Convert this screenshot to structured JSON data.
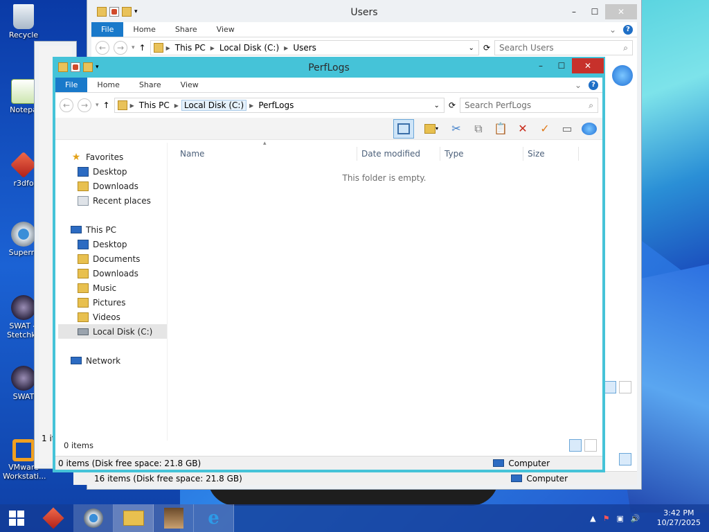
{
  "desktop": {
    "icons": [
      {
        "label": "Recycle",
        "icon": "recycle-bin-icon"
      },
      {
        "label": "Notepa",
        "icon": "notepad-icon"
      },
      {
        "label": "r3dfo",
        "icon": "r3dfox-icon"
      },
      {
        "label": "Superm",
        "icon": "supermium-icon"
      },
      {
        "label": "SWAT 4 Stetchko",
        "icon": "swat4-icon"
      },
      {
        "label": "SWAT",
        "icon": "swat-icon"
      },
      {
        "label": "VMware Workstati...",
        "icon": "vmware-icon"
      }
    ]
  },
  "back_window": {
    "title": "Users",
    "tabs": [
      "File",
      "Home",
      "Share",
      "View"
    ],
    "breadcrumb": [
      "This PC",
      "Local Disk (C:)",
      "Users"
    ],
    "search_placeholder": "Search Users",
    "status_left": "1 it",
    "bottom_status": "16 items (Disk free space: 21.8 GB)",
    "bottom_location": "Computer"
  },
  "window": {
    "title": "PerfLogs",
    "tabs": [
      "File",
      "Home",
      "Share",
      "View"
    ],
    "breadcrumb": [
      "This PC",
      "Local Disk (C:)",
      "PerfLogs"
    ],
    "search_placeholder": "Search PerfLogs",
    "columns": [
      "Name",
      "Date modified",
      "Type",
      "Size"
    ],
    "empty_message": "This folder is empty.",
    "nav": {
      "favorites_label": "Favorites",
      "favorites": [
        "Desktop",
        "Downloads",
        "Recent places"
      ],
      "thispc_label": "This PC",
      "thispc": [
        "Desktop",
        "Documents",
        "Downloads",
        "Music",
        "Pictures",
        "Videos",
        "Local Disk (C:)"
      ],
      "network_label": "Network",
      "selected": "Local Disk (C:)"
    },
    "item_count": "0 items",
    "bottom_status": "0 items (Disk free space: 21.8 GB)",
    "bottom_location": "Computer"
  },
  "back_window_left": {
    "status": "1 it"
  },
  "taskbar": {
    "apps": [
      "start-icon",
      "r3dfox-icon",
      "supermium-icon",
      "file-explorer-icon",
      "game-icon",
      "internet-explorer-icon"
    ],
    "active_app": "file-explorer-icon",
    "time": "3:42 PM",
    "date": "10/27/2025"
  },
  "colors": {
    "accent": "#1979ca",
    "window_border": "#3fc1d6",
    "close_red": "#c7312b"
  }
}
